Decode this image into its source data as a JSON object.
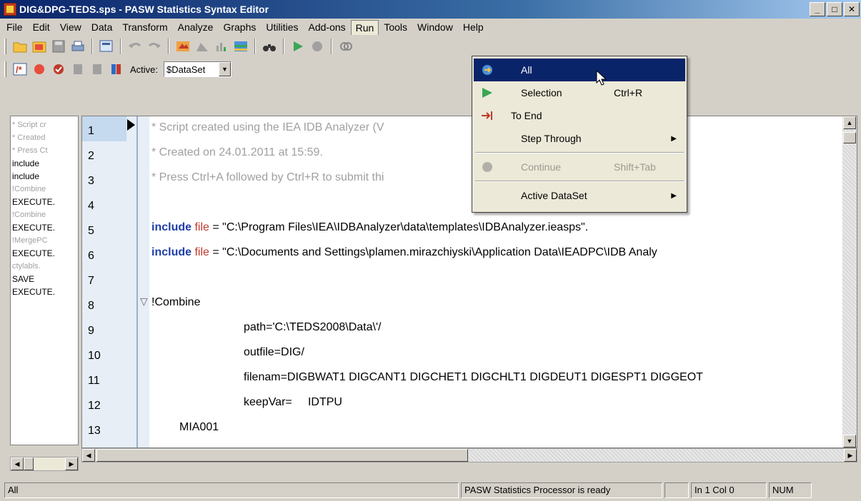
{
  "window": {
    "title": "DIG&DPG-TEDS.sps - PASW Statistics Syntax Editor",
    "buttons": [
      "_",
      "□",
      "✕"
    ]
  },
  "menu": [
    "File",
    "Edit",
    "View",
    "Data",
    "Transform",
    "Analyze",
    "Graphs",
    "Utilities",
    "Add-ons",
    "Run",
    "Tools",
    "Window",
    "Help"
  ],
  "toolbar": {
    "active_label": "Active:",
    "active_dataset": "$DataSet"
  },
  "navigator": [
    {
      "text": "* Script cr",
      "gray": true
    },
    {
      "text": "* Created",
      "gray": true
    },
    {
      "text": "* Press Ct",
      "gray": true
    },
    {
      "text": "include",
      "gray": false
    },
    {
      "text": "include",
      "gray": false
    },
    {
      "text": "!Combine",
      "gray": true
    },
    {
      "text": "EXECUTE.",
      "gray": false
    },
    {
      "text": "!Combine",
      "gray": true
    },
    {
      "text": "EXECUTE.",
      "gray": false
    },
    {
      "text": "!MergePC",
      "gray": true
    },
    {
      "text": "EXECUTE.",
      "gray": false
    },
    {
      "text": "ctylabls.",
      "gray": true
    },
    {
      "text": "SAVE",
      "gray": false
    },
    {
      "text": "EXECUTE.",
      "gray": false
    }
  ],
  "code": {
    "line_numbers": [
      "1",
      "2",
      "3",
      "4",
      "5",
      "6",
      "7",
      "8",
      "9",
      "10",
      "11",
      "12",
      "13"
    ],
    "l1": "* Script created using the IEA IDB Analyzer (V",
    "l2": "* Created on 24.01.2011 at 15:59.",
    "l3": "* Press Ctrl+A followed by Ctrl+R to submit thi",
    "l5_kw": "include",
    "l5_file": "file",
    "l5_rest": " = \"C:\\Program Files\\IEA\\IDBAnalyzer\\data\\templates\\IDBAnalyzer.ieasps\".",
    "l6_kw": "include",
    "l6_file": "file",
    "l6_rest": " = \"C:\\Documents and Settings\\plamen.mirazchiyski\\Application Data\\IEADPC\\IDB Analy",
    "l8": "!Combine",
    "l9": "path='C:\\TEDS2008\\Data\\'/",
    "l10": "outfile=DIG/",
    "l11": "filenam=DIGBWAT1 DIGCANT1 DIGCHET1 DIGCHLT1 DIGDEUT1 DIGESPT1 DIGGEOT",
    "l12": "keepVar=     IDTPU",
    "l13": "MIA001"
  },
  "run_menu": {
    "all": "All",
    "selection": "Selection",
    "selection_shortcut": "Ctrl+R",
    "to_end": "To End",
    "step_through": "Step Through",
    "continue": "Continue",
    "continue_shortcut": "Shift+Tab",
    "active_dataset": "Active DataSet"
  },
  "status": {
    "left": "All",
    "processor": "PASW Statistics Processor is ready",
    "position": "In 1 Col 0",
    "num": "NUM"
  },
  "colors": {
    "titlebar": "#0a246a",
    "highlight": "#0a246a",
    "keyword": "#1f3fa8",
    "comment": "#a0a0a0"
  }
}
